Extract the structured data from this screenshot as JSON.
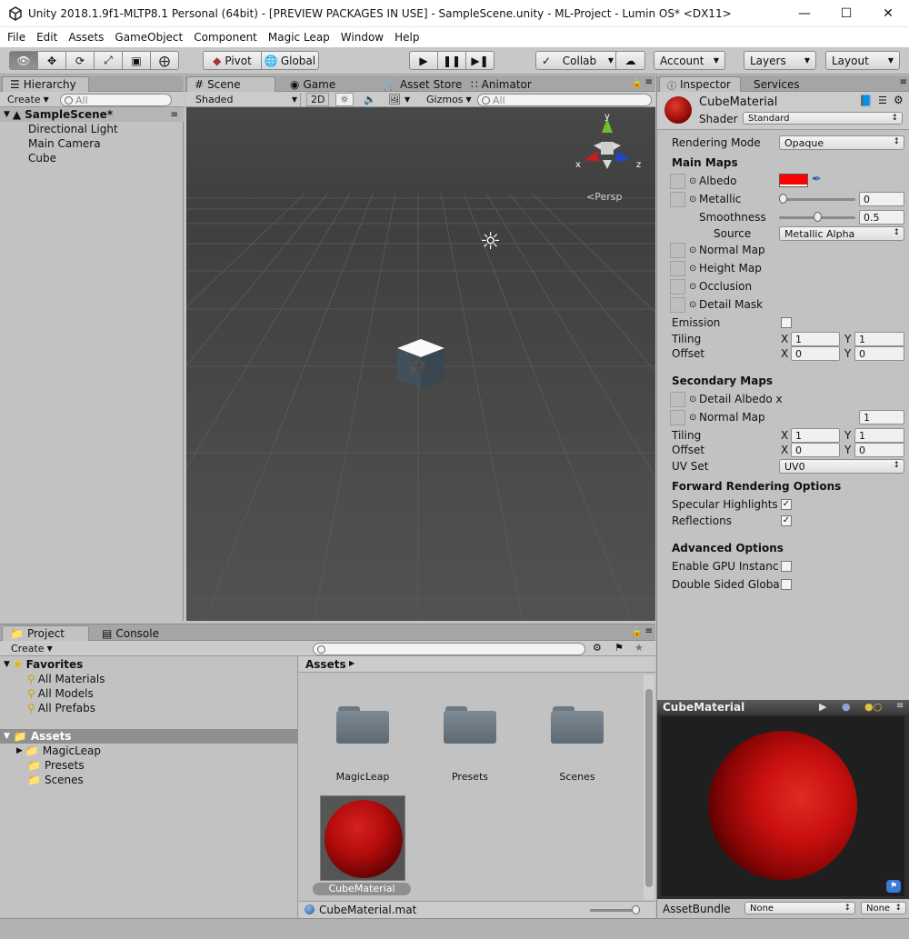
{
  "window": {
    "title": "Unity 2018.1.9f1-MLTP8.1 Personal (64bit) - [PREVIEW PACKAGES IN USE] - SampleScene.unity - ML-Project - Lumin OS* <DX11>"
  },
  "menu": [
    "File",
    "Edit",
    "Assets",
    "GameObject",
    "Component",
    "Magic Leap",
    "Window",
    "Help"
  ],
  "toolbar": {
    "pivot": "Pivot",
    "global": "Global",
    "collab": "Collab",
    "account": "Account",
    "layers": "Layers",
    "layout": "Layout"
  },
  "hierarchy": {
    "tab": "Hierarchy",
    "create": "Create",
    "search_placeholder": "All",
    "scene": "SampleScene*",
    "items": [
      "Directional Light",
      "Main Camera",
      "Cube"
    ]
  },
  "scene": {
    "tabs": [
      "Scene",
      "Game",
      "Asset Store",
      "Animator"
    ],
    "shading": "Shaded",
    "mode2d": "2D",
    "gizmos": "Gizmos",
    "search_placeholder": "All",
    "persp": "Persp",
    "axis_x": "x",
    "axis_y": "y",
    "axis_z": "z"
  },
  "inspector": {
    "tabs": [
      "Inspector",
      "Services"
    ],
    "material_name": "CubeMaterial",
    "shader_label": "Shader",
    "shader": "Standard",
    "rendering_mode_label": "Rendering Mode",
    "rendering_mode": "Opaque",
    "main_maps": "Main Maps",
    "albedo": "Albedo",
    "albedo_color": "#ff0000",
    "metallic": "Metallic",
    "metallic_value": "0",
    "metallic_slider": 0,
    "smoothness": "Smoothness",
    "smoothness_value": "0.5",
    "smoothness_slider": 0.5,
    "source": "Source",
    "source_value": "Metallic Alpha",
    "normal_map": "Normal Map",
    "height_map": "Height Map",
    "occlusion": "Occlusion",
    "detail_mask": "Detail Mask",
    "emission": "Emission",
    "tiling": "Tiling",
    "offset": "Offset",
    "x": "X",
    "y": "Y",
    "tiling_x": "1",
    "tiling_y": "1",
    "offset_x": "0",
    "offset_y": "0",
    "secondary_maps": "Secondary Maps",
    "detail_albedo": "Detail Albedo x",
    "normal_map2": "Normal Map",
    "normal_map2_value": "1",
    "tiling2_x": "1",
    "tiling2_y": "1",
    "offset2_x": "0",
    "offset2_y": "0",
    "uv_set": "UV Set",
    "uv_set_value": "UV0",
    "forward_rendering": "Forward Rendering Options",
    "specular": "Specular Highlights",
    "reflections": "Reflections",
    "advanced": "Advanced Options",
    "gpu_instancing": "Enable GPU Instancin",
    "double_sided": "Double Sided Global",
    "preview_title": "CubeMaterial",
    "assetbundle": "AssetBundle",
    "bundle_none1": "None",
    "bundle_none2": "None"
  },
  "project": {
    "tabs": [
      "Project",
      "Console"
    ],
    "create": "Create",
    "favorites": "Favorites",
    "fav_items": [
      "All Materials",
      "All Models",
      "All Prefabs"
    ],
    "assets": "Assets",
    "asset_folders": [
      "MagicLeap",
      "Presets",
      "Scenes"
    ],
    "breadcrumb": "Assets",
    "grid": [
      {
        "name": "MagicLeap"
      },
      {
        "name": "Presets"
      },
      {
        "name": "Scenes"
      },
      {
        "name": "CubeMaterial"
      }
    ],
    "selected_file": "CubeMaterial.mat"
  }
}
